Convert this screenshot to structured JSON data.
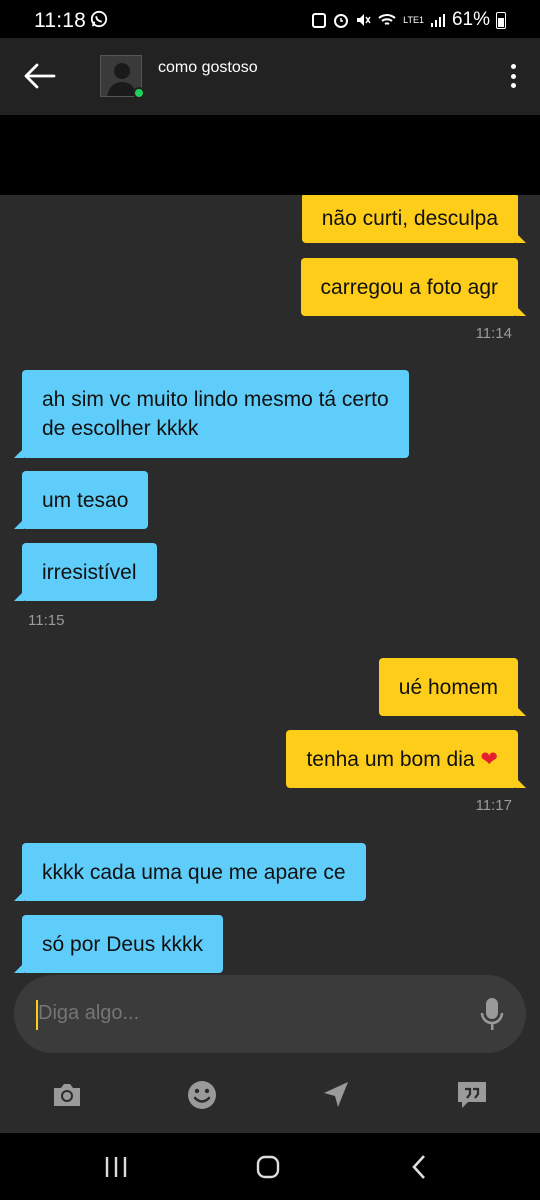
{
  "status_bar": {
    "time": "11:18",
    "battery": "61%",
    "network": "LTE1"
  },
  "header": {
    "contact_name": "como gostoso",
    "online": true
  },
  "messages": [
    {
      "side": "out",
      "text": "não curti, desculpa"
    },
    {
      "side": "out",
      "text": "carregou a foto agr"
    },
    {
      "timestamp": "11:14"
    },
    {
      "side": "in",
      "line1": "ah sim vc muito lindo mesmo tá certo",
      "line2": "de escolher kkkk"
    },
    {
      "side": "in",
      "text": "um tesao"
    },
    {
      "side": "in",
      "text": "irresistível"
    },
    {
      "timestamp": "11:15"
    },
    {
      "side": "out",
      "text": "ué homem"
    },
    {
      "side": "out",
      "text": "tenha um bom dia",
      "emoji": "❤"
    },
    {
      "timestamp": "11:17"
    },
    {
      "side": "in",
      "text": "kkkk cada uma que me apare ce"
    },
    {
      "side": "in",
      "text": "só por Deus kkkk"
    }
  ],
  "composer": {
    "placeholder": "Diga algo..."
  },
  "toolbar": {
    "items": [
      "camera-icon",
      "smiley-icon",
      "location-icon",
      "saved-phrases-icon"
    ]
  },
  "nav": {
    "items": [
      "recent-apps-icon",
      "home-icon",
      "back-icon"
    ]
  },
  "colors": {
    "outgoing": "#fecd1a",
    "incoming": "#5fcdfa",
    "background": "#2b2b2b",
    "header": "#222222"
  }
}
